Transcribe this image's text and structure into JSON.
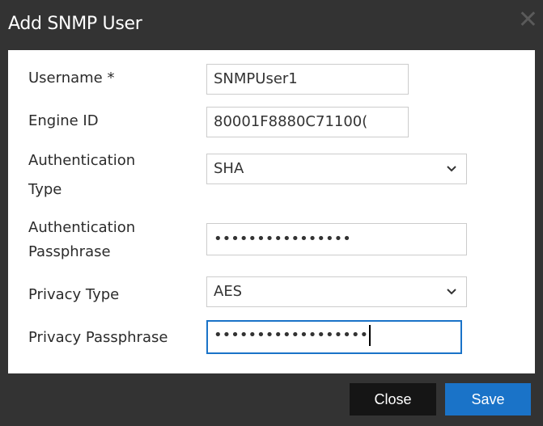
{
  "dialog": {
    "title": "Add SNMP User",
    "close_icon": "close-icon"
  },
  "form": {
    "username": {
      "label": "Username *",
      "value": "SNMPUser1"
    },
    "engine_id": {
      "label": "Engine ID",
      "value": "80001F8880C71100("
    },
    "auth_type": {
      "label_line1": "Authentication",
      "label_line2": "Type",
      "value": "SHA"
    },
    "auth_passphrase": {
      "label_line1": "Authentication",
      "label_line2": "Passphrase",
      "value": "••••••••••••••••"
    },
    "privacy_type": {
      "label": "Privacy Type",
      "value": "AES"
    },
    "privacy_passphrase": {
      "label": "Privacy Passphrase",
      "value": "••••••••••••••••••"
    }
  },
  "footer": {
    "close_label": "Close",
    "save_label": "Save"
  },
  "colors": {
    "accent": "#1a73c8",
    "header_bg": "#333333",
    "close_button_bg": "#151515"
  }
}
